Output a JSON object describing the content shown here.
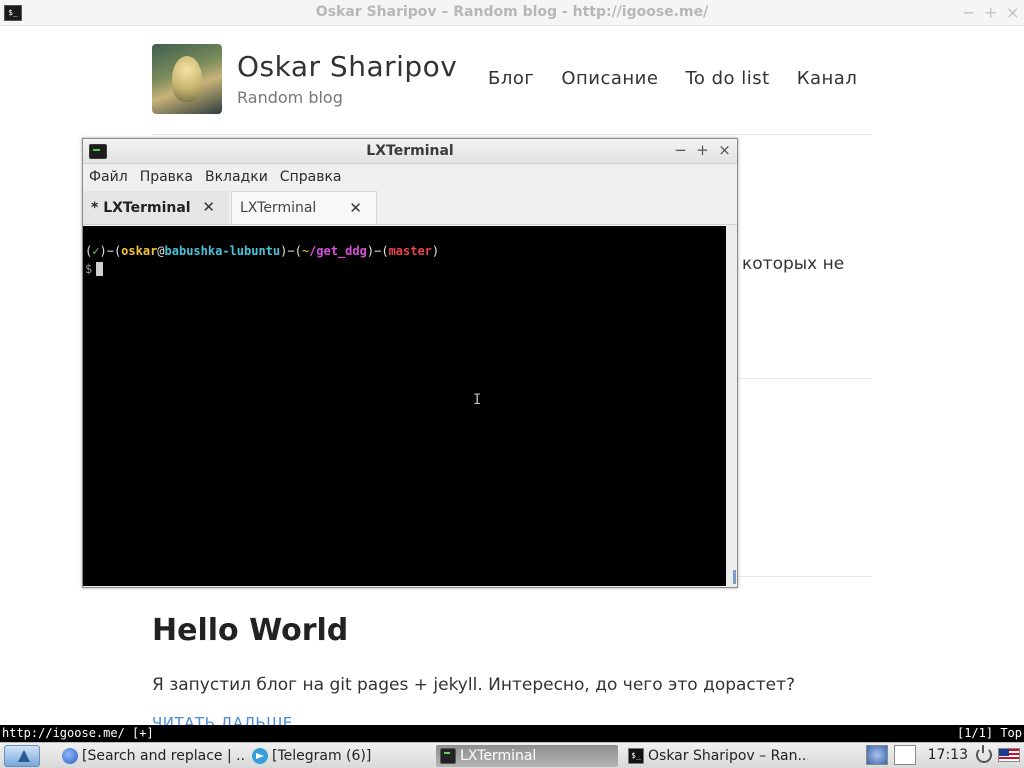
{
  "browser": {
    "title": "Oskar Sharipov – Random blog - http://igoose.me/",
    "app_icon": "$_",
    "controls": {
      "minimize": "−",
      "maximize": "+",
      "close": "×"
    }
  },
  "blog": {
    "name": "Oskar Sharipov",
    "tagline": "Random blog",
    "nav": [
      "Блог",
      "Описание",
      "To do list",
      "Канал"
    ],
    "snippet": "которых не",
    "post_title": "Hello World",
    "post_text": "Я запустил блог на git pages + jekyll. Интересно, до чего это дорастет?",
    "read_more": "ЧИТАТЬ ДАЛЬШЕ"
  },
  "terminal": {
    "title": "LXTerminal",
    "controls": {
      "minimize": "−",
      "maximize": "+",
      "close": "×"
    },
    "menu": [
      "Файл",
      "Правка",
      "Вкладки",
      "Справка"
    ],
    "tabs": [
      {
        "label": "* LXTerminal",
        "active": true,
        "close": "✕"
      },
      {
        "label": "LXTerminal",
        "active": false,
        "close": "✕"
      }
    ],
    "prompt": {
      "open1": "(",
      "check": "✓",
      "close1": ")",
      "dash1": "−",
      "open2": "(",
      "user": "oskar",
      "at": "@",
      "host": "babushka-lubuntu",
      "close2": ")",
      "dash2": "−",
      "open3": "(",
      "tilde": "~",
      "dir": "/get_ddg",
      "close3": ")",
      "dash3": "−",
      "open4": "(",
      "branch": "master",
      "close4": ")",
      "dollar": "$"
    }
  },
  "statusbar": {
    "url": "http://igoose.me/ [+]",
    "position": "[1/1] Top"
  },
  "taskbar": {
    "tasks": [
      {
        "label": "[Search and replace | ...",
        "icon": "firefox-icon"
      },
      {
        "label": "[Telegram (6)]",
        "icon": "telegram-icon"
      },
      {
        "label": "LXTerminal",
        "icon": "terminal-icon"
      },
      {
        "label": "Oskar Sharipov – Ran...",
        "icon": "terminal-app-icon"
      }
    ],
    "clock": "17:13",
    "colors": {
      "active_task": "#9a9a9a",
      "accent": "#2a5a95"
    }
  },
  "colors": {
    "link": "#4a8cd8",
    "prompt_user": "#f3c33b",
    "prompt_host": "#49c3d8",
    "prompt_dir": "#d94fd9",
    "prompt_branch": "#e8434b"
  }
}
